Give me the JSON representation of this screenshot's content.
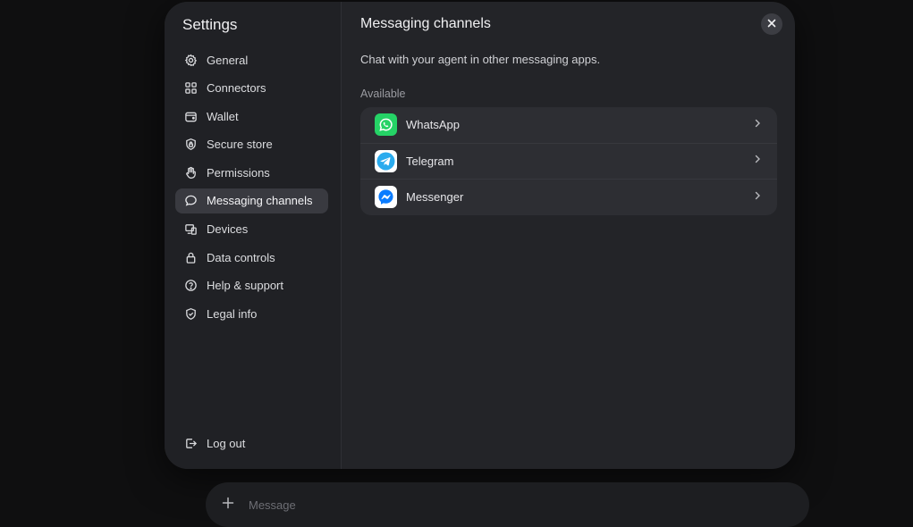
{
  "settings": {
    "title": "Settings",
    "nav": [
      {
        "label": "General",
        "icon": "gear-icon"
      },
      {
        "label": "Connectors",
        "icon": "grid-icon"
      },
      {
        "label": "Wallet",
        "icon": "wallet-icon"
      },
      {
        "label": "Secure store",
        "icon": "shield-lock-icon"
      },
      {
        "label": "Permissions",
        "icon": "hand-icon"
      },
      {
        "label": "Messaging channels",
        "icon": "chat-bubble-icon",
        "active": true
      },
      {
        "label": "Devices",
        "icon": "devices-icon"
      },
      {
        "label": "Data controls",
        "icon": "lock-icon"
      },
      {
        "label": "Help & support",
        "icon": "help-circle-icon"
      },
      {
        "label": "Legal info",
        "icon": "shield-check-icon"
      }
    ],
    "logout_label": "Log out"
  },
  "main": {
    "title": "Messaging channels",
    "subtitle": "Chat with your agent in other messaging apps.",
    "section_label": "Available",
    "channels": [
      {
        "name": "WhatsApp",
        "icon": "whatsapp-icon",
        "color": "#25D366"
      },
      {
        "name": "Telegram",
        "icon": "telegram-icon",
        "color": "#2AABEE"
      },
      {
        "name": "Messenger",
        "icon": "messenger-icon",
        "color": "#0A7CFF"
      }
    ]
  },
  "composer": {
    "placeholder": "Message"
  },
  "colors": {
    "modal_bg": "#232428",
    "active_item_bg": "#393a40",
    "list_bg": "#2d2e33"
  }
}
